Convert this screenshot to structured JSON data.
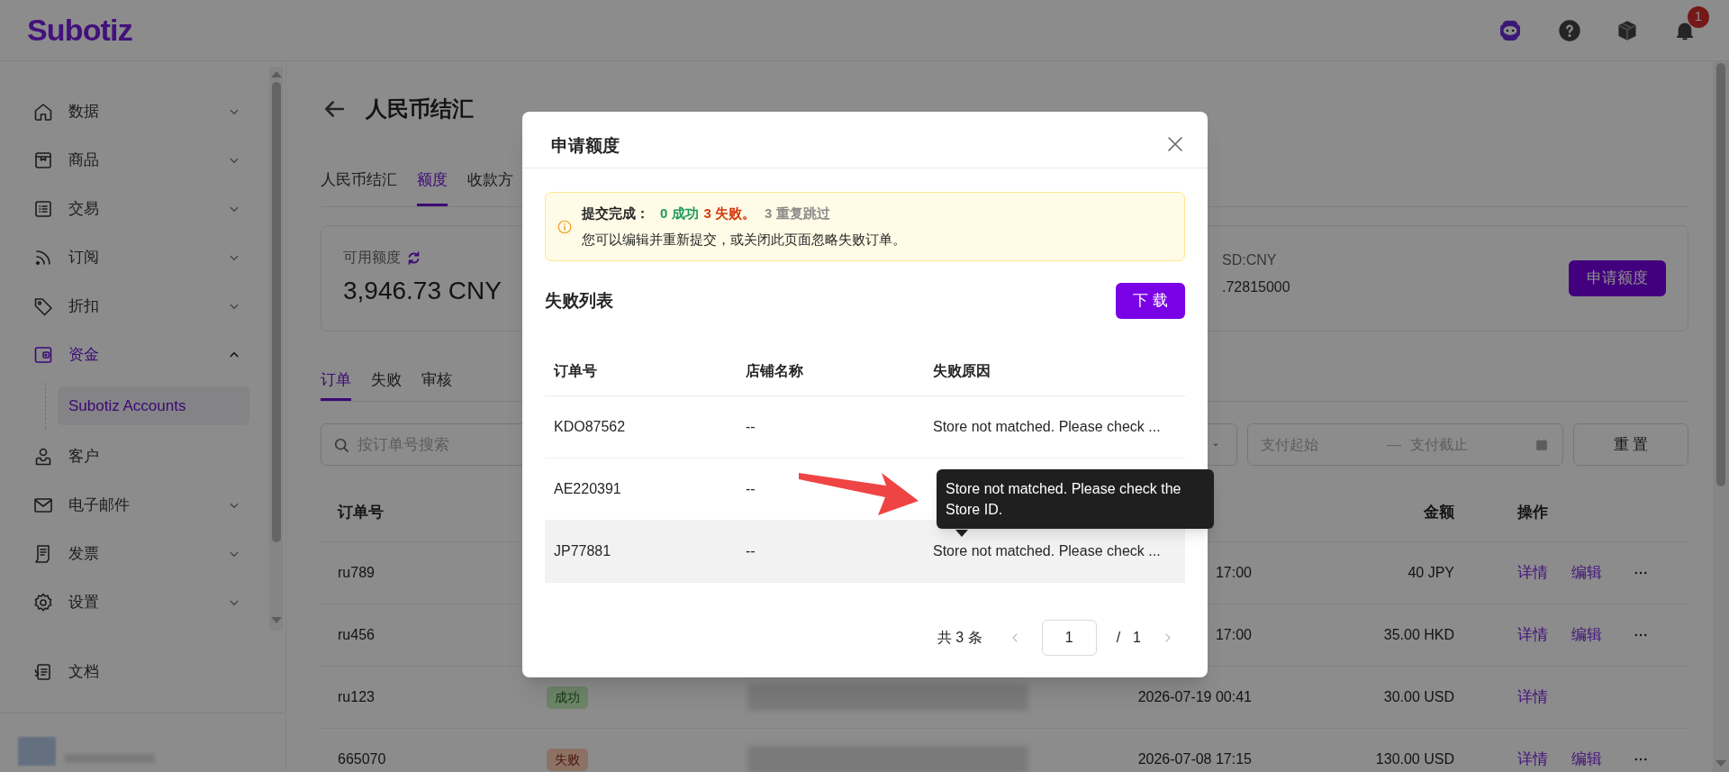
{
  "header": {
    "logo": "Subotiz",
    "notification_count": "1"
  },
  "sidebar": {
    "items": [
      {
        "label": "数据",
        "expanded": false,
        "selected": false
      },
      {
        "label": "商品",
        "expanded": false,
        "selected": false
      },
      {
        "label": "交易",
        "expanded": false,
        "selected": false
      },
      {
        "label": "订阅",
        "expanded": false,
        "selected": false
      },
      {
        "label": "折扣",
        "expanded": false,
        "selected": false
      },
      {
        "label": "资金",
        "expanded": true,
        "selected": true,
        "children": [
          {
            "label": "Subotiz Accounts",
            "selected": true
          }
        ]
      },
      {
        "label": "客户",
        "selected": false
      },
      {
        "label": "电子邮件",
        "expanded": false,
        "selected": false
      },
      {
        "label": "发票",
        "expanded": false,
        "selected": false
      },
      {
        "label": "设置",
        "expanded": false,
        "selected": false
      }
    ],
    "footer_items": [
      {
        "label": "文档",
        "selected": false
      }
    ]
  },
  "page": {
    "title": "人民币结汇",
    "tabs": [
      {
        "label": "人民币结汇",
        "selected": false
      },
      {
        "label": "额度",
        "selected": true
      },
      {
        "label": "收款方",
        "selected": false
      }
    ],
    "quota": {
      "label": "可用额度",
      "amount": "3,946.73 CNY",
      "rate_label": "SD:CNY",
      "rate_value": ".72815000",
      "apply_button": "申请额度"
    },
    "sub_tabs": [
      {
        "label": "订单",
        "selected": true
      },
      {
        "label": "失败",
        "selected": false
      },
      {
        "label": "审核",
        "selected": false
      }
    ],
    "filters": {
      "search_placeholder": "按订单号搜索",
      "date_start_placeholder": "支付起始",
      "date_separator": "—",
      "date_end_placeholder": "支付截止",
      "reset_button": "重 置"
    },
    "table": {
      "column_order": "订单号",
      "column_amount": "金额",
      "column_actions": "操作",
      "rows": [
        {
          "order": "ru789",
          "time": "17:00",
          "amount": "40 JPY",
          "actions": [
            "详情",
            "编辑"
          ],
          "more_menu": true
        },
        {
          "order": "ru456",
          "time": "17:00",
          "amount": "35.00 HKD",
          "actions": [
            "详情",
            "编辑"
          ],
          "more_menu": true
        },
        {
          "order": "ru123",
          "status": "成功",
          "kind": "success",
          "time": "2026-07-19 00:41",
          "amount": "30.00 USD",
          "actions": [
            "详情"
          ],
          "more_menu": false
        },
        {
          "order": "665070",
          "status": "失败",
          "kind": "failure",
          "time": "2026-07-08 17:15",
          "amount": "130.00 USD",
          "actions": [
            "详情",
            "编辑"
          ],
          "more_menu": true
        }
      ]
    }
  },
  "modal": {
    "title": "申请额度",
    "alert": {
      "summary_label": "提交完成：",
      "success_text": "0 成功",
      "failed_text": "3 失败。",
      "skipped_text": "3 重复跳过",
      "message": "您可以编辑并重新提交，或关闭此页面忽略失败订单。"
    },
    "list_title": "失败列表",
    "download_button": "下 载",
    "columns": [
      "订单号",
      "店铺名称",
      "失败原因"
    ],
    "rows": [
      {
        "order": "KDO87562",
        "store": "--",
        "reason": "Store not matched. Please check ...",
        "highlighted": false
      },
      {
        "order": "AE220391",
        "store": "--",
        "highlighted": false
      },
      {
        "order": "JP77881",
        "store": "--",
        "reason": "Store not matched. Please check ...",
        "highlighted": true,
        "tooltip": "Store not matched. Please check the Store ID."
      }
    ],
    "pagination": {
      "total": "共 3 条",
      "page": "1",
      "separator": "/",
      "page_count": "1"
    }
  }
}
